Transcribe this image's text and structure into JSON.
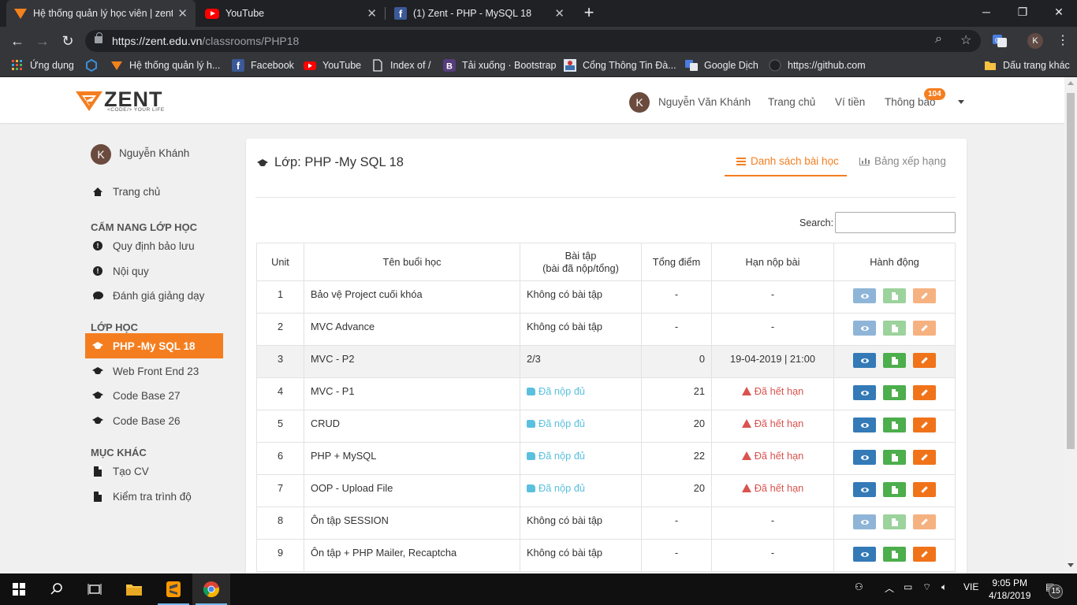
{
  "browser": {
    "tabs": [
      {
        "title": "Hệ thống quản lý học viên | zent",
        "active": true,
        "favicon": "zent-icon"
      },
      {
        "title": "YouTube",
        "active": false,
        "favicon": "youtube-icon"
      },
      {
        "title": "(1) Zent - PHP - MySQL 18",
        "active": false,
        "favicon": "facebook-icon"
      }
    ],
    "url_host": "https://zent.edu.vn",
    "url_path": "/classrooms/PHP18",
    "profile_initial": "K",
    "bookmarks": [
      {
        "label": "Ứng dụng",
        "icon": "apps-grid-icon"
      },
      {
        "label": "",
        "icon": "hex-icon"
      },
      {
        "label": "Hệ thống quản lý h...",
        "icon": "zent-icon"
      },
      {
        "label": "Facebook",
        "icon": "facebook-icon"
      },
      {
        "label": "YouTube",
        "icon": "youtube-icon"
      },
      {
        "label": "Index of /",
        "icon": "page-icon"
      },
      {
        "label": "Tải xuống · Bootstrap",
        "icon": "bootstrap-icon"
      },
      {
        "label": "Cổng Thông Tin Đà...",
        "icon": "portal-icon"
      },
      {
        "label": "Google Dịch",
        "icon": "google-translate-icon"
      },
      {
        "label": "https://github.com",
        "icon": "github-icon"
      }
    ],
    "other_bookmarks": "Dấu trang khác"
  },
  "header": {
    "logo_text": "ZENT",
    "logo_tag": "<CODE/> YOUR LIFE",
    "user_initial": "K",
    "user_name": "Nguyễn Văn Khánh",
    "nav": [
      "Trang chủ",
      "Ví tiền",
      "Thông báo"
    ],
    "notification_count": "104"
  },
  "sidebar": {
    "user_initial": "K",
    "user_name": "Nguyễn Khánh",
    "home": "Trang chủ",
    "sections": [
      {
        "title": "CẨM NANG LỚP HỌC",
        "items": [
          "Quy định bảo lưu",
          "Nội quy",
          "Đánh giá giảng dạy"
        ]
      },
      {
        "title": "LỚP HỌC",
        "items": [
          "PHP -My SQL 18",
          "Web Front End 23",
          "Code Base 27",
          "Code Base 26"
        ]
      },
      {
        "title": "MỤC KHÁC",
        "items": [
          "Tạo CV",
          "Kiểm tra trình độ"
        ]
      }
    ],
    "active_item": "PHP -My SQL 18"
  },
  "main": {
    "title": "Lớp: PHP -My SQL 18",
    "tabs": [
      "Danh sách bài học",
      "Bảng xếp hạng"
    ],
    "active_tab": "Danh sách bài học",
    "search_label": "Search:",
    "search_value": "",
    "columns": [
      "Unit",
      "Tên buổi học",
      "Bài tập",
      "(bài đã nộp/tổng)",
      "Tổng điểm",
      "Hạn nộp bài",
      "Hành động"
    ],
    "rows": [
      {
        "unit": "1",
        "name": "Bảo vệ Project cuối khóa",
        "homework": "Không có bài tập",
        "score": "-",
        "deadline": "-",
        "status": "none"
      },
      {
        "unit": "2",
        "name": "MVC Advance",
        "homework": "Không có bài tập",
        "score": "-",
        "deadline": "-",
        "status": "none"
      },
      {
        "unit": "3",
        "name": "MVC - P2",
        "homework": "2/3",
        "score": "0",
        "deadline": "19-04-2019 | 21:00",
        "status": "open"
      },
      {
        "unit": "4",
        "name": "MVC - P1",
        "homework": "Đã nộp đủ",
        "score": "21",
        "deadline": "Đã hết hạn",
        "status": "done"
      },
      {
        "unit": "5",
        "name": "CRUD",
        "homework": "Đã nộp đủ",
        "score": "20",
        "deadline": "Đã hết hạn",
        "status": "done"
      },
      {
        "unit": "6",
        "name": "PHP + MySQL",
        "homework": "Đã nộp đủ",
        "score": "22",
        "deadline": "Đã hết hạn",
        "status": "done"
      },
      {
        "unit": "7",
        "name": "OOP - Upload File",
        "homework": "Đã nộp đủ",
        "score": "20",
        "deadline": "Đã hết hạn",
        "status": "done"
      },
      {
        "unit": "8",
        "name": "Ôn tập SESSION",
        "homework": "Không có bài tập",
        "score": "-",
        "deadline": "-",
        "status": "none"
      },
      {
        "unit": "9",
        "name": "Ôn tập + PHP Mailer, Recaptcha",
        "homework": "Không có bài tập",
        "score": "-",
        "deadline": "-",
        "status": "none-active"
      }
    ]
  },
  "taskbar": {
    "language": "VIE",
    "time": "9:05 PM",
    "date": "4/18/2019",
    "notifications": "15"
  },
  "colors": {
    "accent": "#f47e1f",
    "primary": "#337ab7",
    "success": "#4cae4c",
    "info": "#5bc0de",
    "danger": "#d9534f"
  }
}
